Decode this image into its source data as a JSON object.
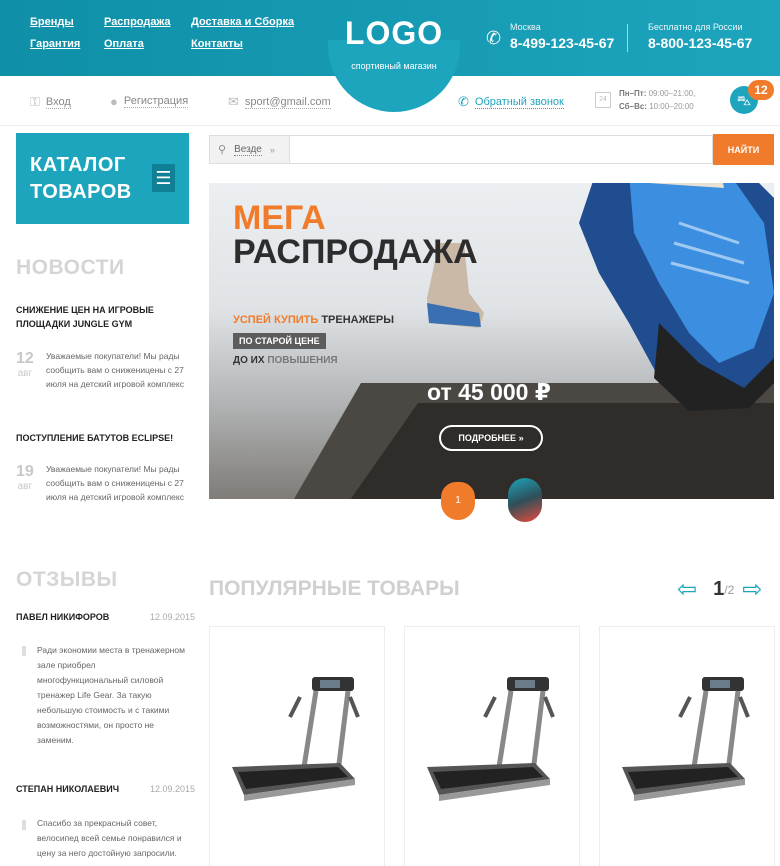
{
  "header": {
    "nav": [
      "Бренды",
      "Распродажа",
      "Доставка и Сборка",
      "Гарантия",
      "Оплата",
      "Контакты"
    ],
    "logo": "LOGO",
    "logo_sub": "спортивный магазин",
    "phone1": {
      "city": "Москва",
      "number": "8-499-123-45-67"
    },
    "phone2": {
      "city": "Бесплатно для России",
      "number": "8-800-123-45-67"
    }
  },
  "subbar": {
    "login": "Вход",
    "register": "Регистрация",
    "email": "sport@gmail.com",
    "callback": "Обратный звонок",
    "calendar_day": "24",
    "hours_weekdays_label": "Пн–Пт:",
    "hours_weekdays": "09:00–21:00,",
    "hours_weekend_label": "Сб–Вс:",
    "hours_weekend": "10:00–20:00",
    "cart_count": "12"
  },
  "sidebar": {
    "catalog_line1": "КАТАЛОГ",
    "catalog_line2": "ТОВАРОВ",
    "news_heading": "НОВОСТИ",
    "news": [
      {
        "title": "СНИЖЕНИЕ ЦЕН НА ИГРОВЫЕ ПЛОЩАДКИ JUNGLE GYM",
        "day": "12",
        "month": "авг",
        "text": "Уважаемые покупатели! Мы рады сообщить вам о сниженицены с 27 июля на детский игровой комплекс"
      },
      {
        "title": "ПОСТУПЛЕНИЕ БАТУТОВ ECLIPSE!",
        "day": "19",
        "month": "авг",
        "text": "Уважаемые покупатели! Мы рады сообщить вам о сниженицены с 27 июля на детский игровой комплекс"
      }
    ],
    "reviews_heading": "ОТЗЫВЫ",
    "reviews": [
      {
        "name": "ПАВЕЛ НИКИФОРОВ",
        "date": "12.09.2015",
        "text": "Ради экономии места в тренажерном зале приобрел многофункциональный силовой тренажер Life Gear. За такую небольшую стоимость и с такими возможностями, он просто не заменим."
      },
      {
        "name": "СТЕПАН НИКОЛАЕВИЧ",
        "date": "12.09.2015",
        "text": "Спасибо за прекрасный совет, велосипед всей семье понравился и цену за него достойную запросили."
      }
    ]
  },
  "search": {
    "scope": "Везде",
    "placeholder": "",
    "button": "НАЙТИ"
  },
  "banner": {
    "mega": "МЕГА",
    "sale": "РАСПРОДАЖА",
    "line1_accent": "УСПЕЙ КУПИТЬ",
    "line1_rest": "ТРЕНАЖЕРЫ",
    "tag": "ПО СТАРОЙ ЦЕНЕ",
    "line3_a": "ДО ИХ",
    "line3_b": "ПОВЫШЕНИЯ",
    "price": "от 45 000 ₽",
    "button": "ПОДРОБНЕЕ",
    "slide_current": "1"
  },
  "popular": {
    "heading": "ПОПУЛЯРНЫЕ ТОВАРЫ",
    "page_current": "1",
    "page_total": "/2"
  },
  "colors": {
    "accent": "#1da5bd",
    "orange": "#f07b2a"
  },
  "icons": {
    "phone": "phone-icon",
    "login": "key-icon",
    "register": "user-icon",
    "email": "mail-icon",
    "callback": "phone-icon",
    "cart": "basket-icon",
    "search": "search-icon"
  }
}
